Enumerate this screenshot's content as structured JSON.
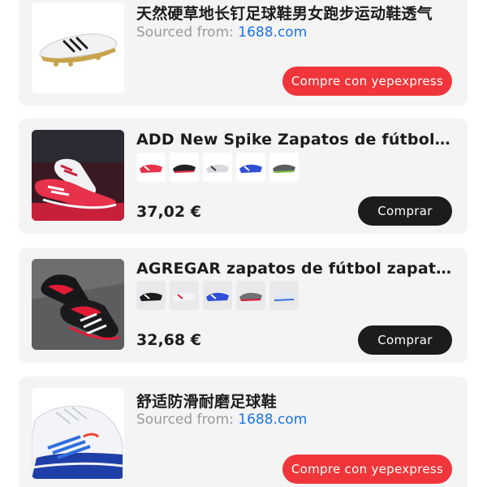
{
  "products": [
    {
      "title": "天然硬草地长钉足球鞋男女跑步运动鞋透气",
      "sourced_label": "Sourced from:",
      "sourced_site": "1688.com",
      "button": "Compre con yepexpress",
      "image_icon": "white-gold-football-boot"
    },
    {
      "title": "ADD New Spike Zapatos de fútbol c...",
      "variants": [
        "red-white-boot",
        "black-red-boot",
        "white-silver-boot",
        "blue-boot",
        "grey-green-boot"
      ],
      "price": "37,02 €",
      "button": "Comprar",
      "image_icon": "red-white-boots-pair"
    },
    {
      "title": "AGREGAR zapatos de fútbol zapatill...",
      "variants": [
        "black-white-boot",
        "white-red-boot",
        "blue-boot",
        "grey-red-boot",
        "white-blue-boot"
      ],
      "price": "32,68 €",
      "button": "Comprar",
      "image_icon": "black-red-boots-pair"
    },
    {
      "title": "舒适防滑耐磨足球鞋",
      "sourced_label": "Sourced from:",
      "sourced_site": "1688.com",
      "button": "Compre con yepexpress",
      "image_icon": "white-blue-indoor-shoe"
    }
  ],
  "colors": {
    "card_bg": "#f4f4f5",
    "accent_red": "#f0363a",
    "button_dark": "#1c1c1e",
    "link_blue": "#1a73e8",
    "muted_text": "#9a9a9e"
  }
}
